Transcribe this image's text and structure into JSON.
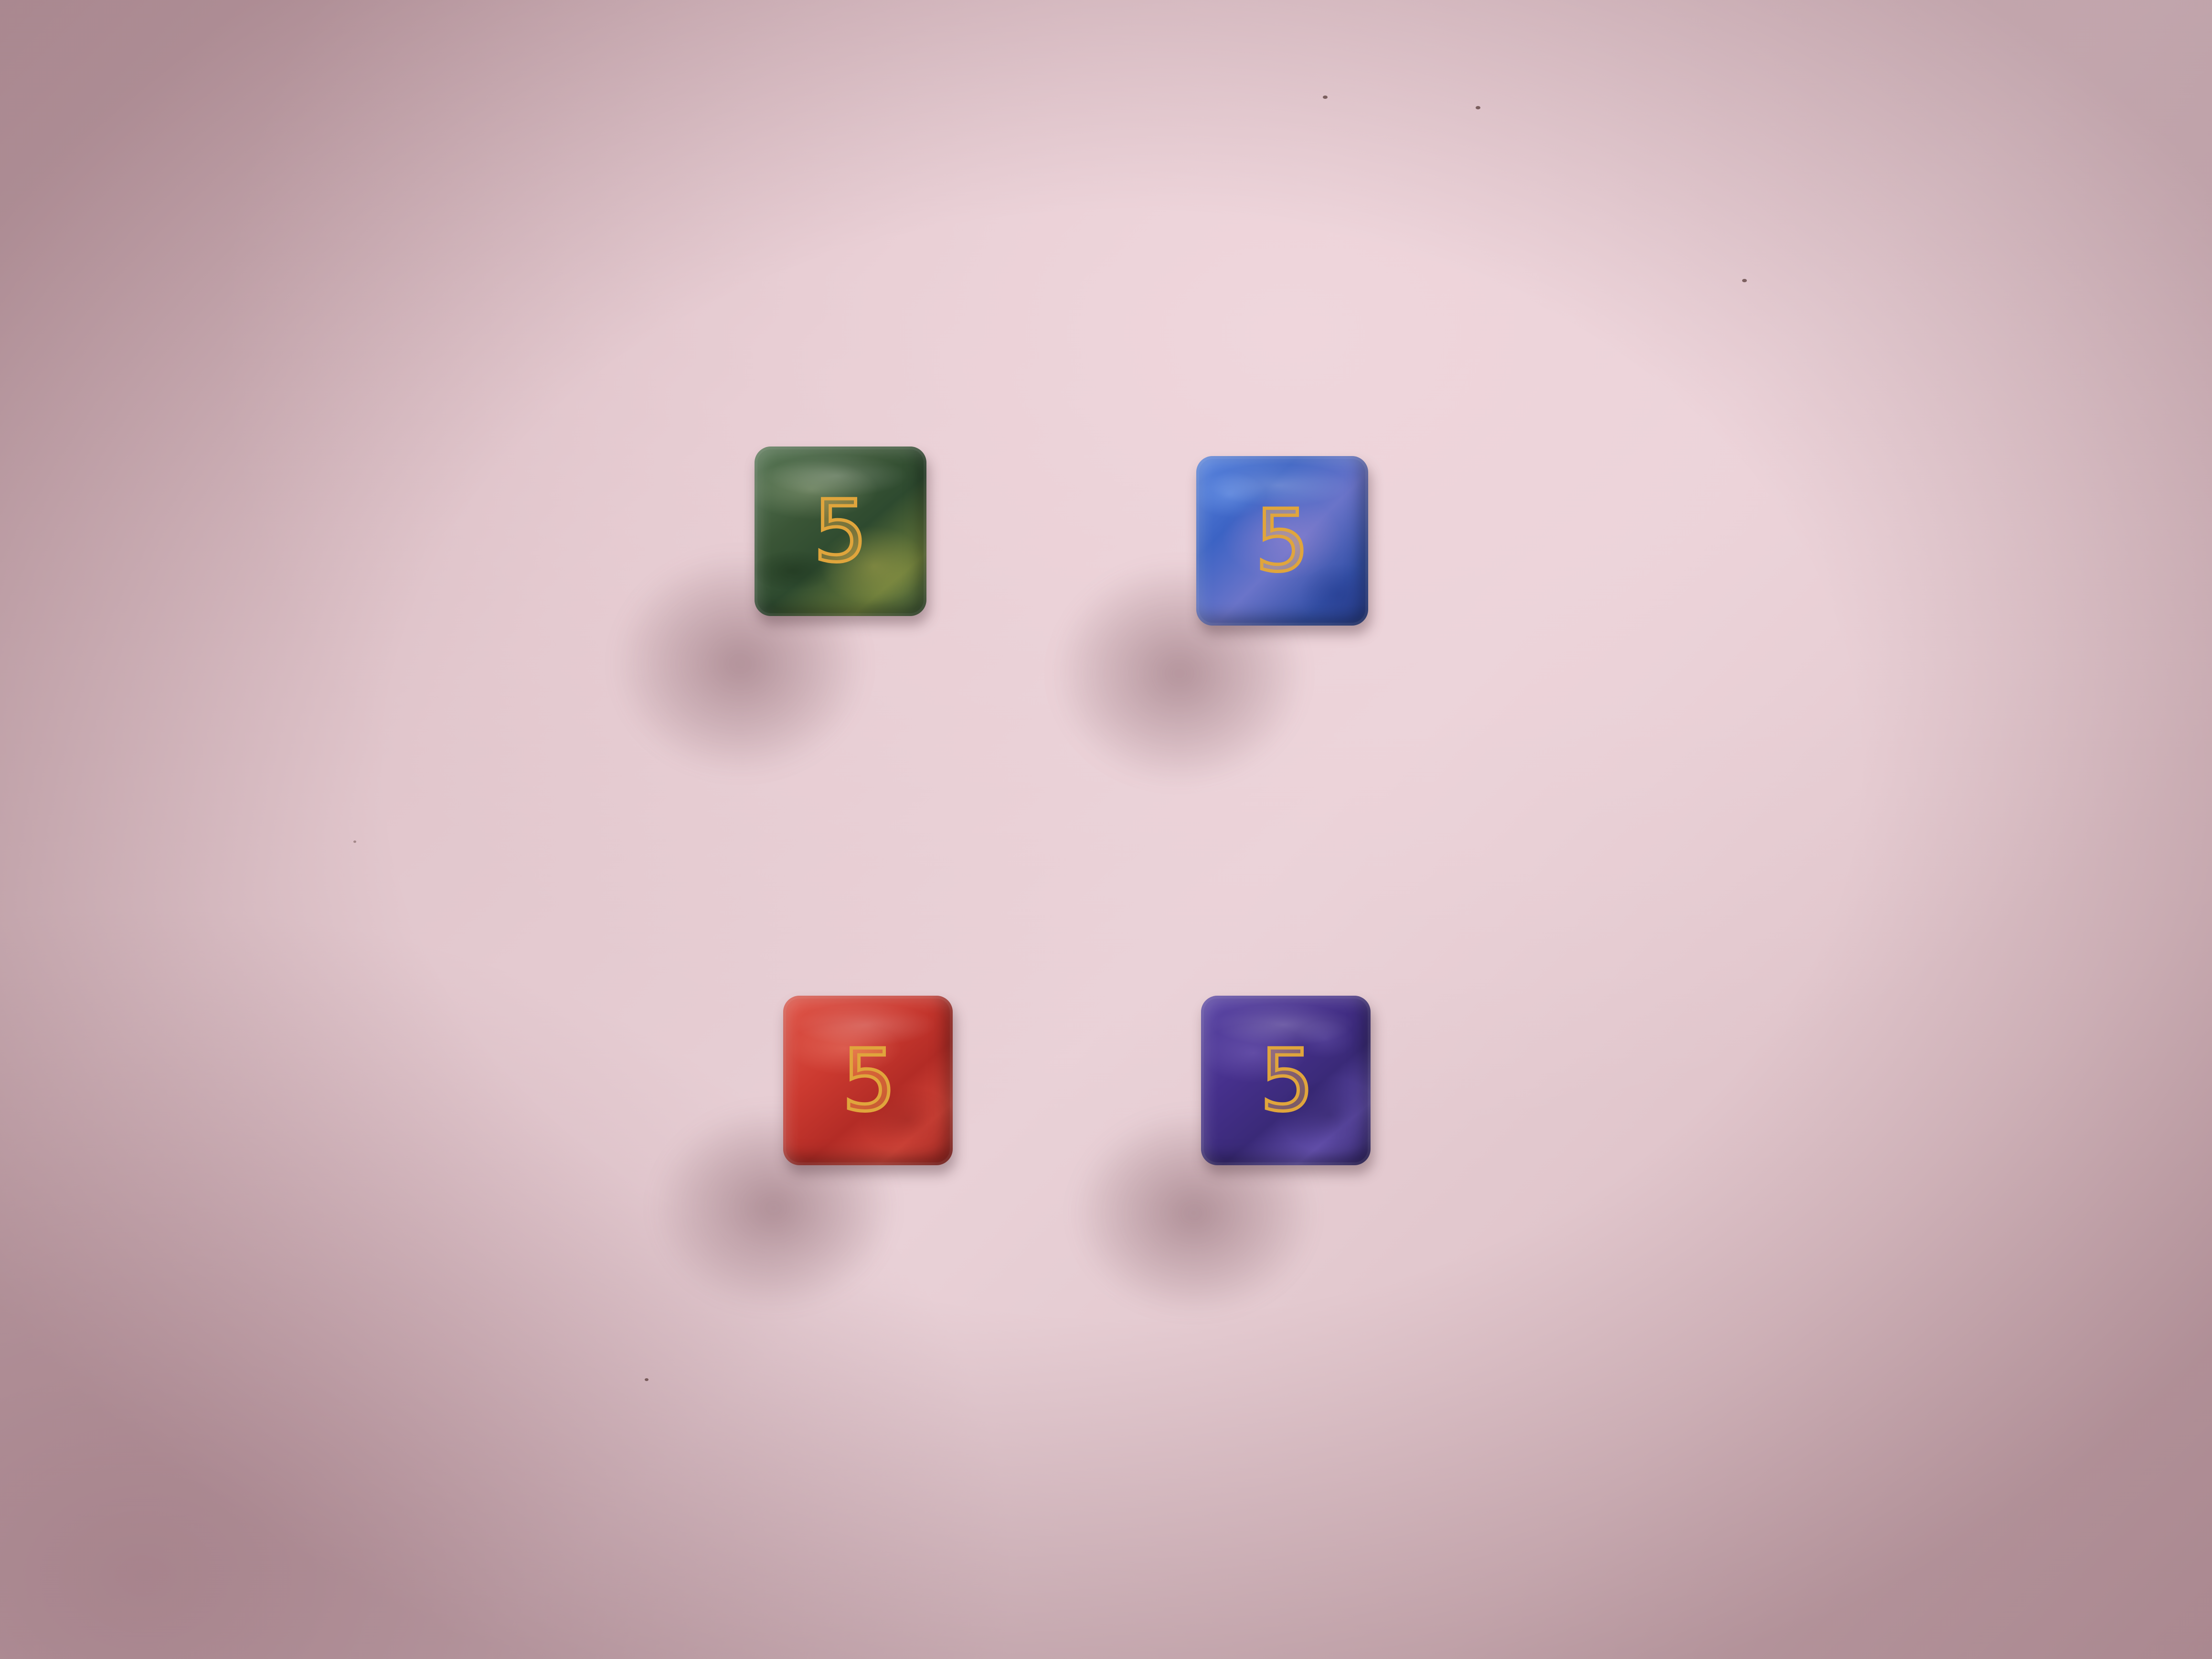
{
  "scene": {
    "description_free": true,
    "surface_color": "#e5cdd3"
  },
  "dice": [
    {
      "id": "green",
      "face_value": "5",
      "color": "#3f5a3c",
      "pip_color": "#e0a53c"
    },
    {
      "id": "blue",
      "face_value": "5",
      "color": "#3f5fb8",
      "pip_color": "#e0a53c"
    },
    {
      "id": "red",
      "face_value": "5",
      "color": "#c2362e",
      "pip_color": "#e0a53c"
    },
    {
      "id": "purple",
      "face_value": "5",
      "color": "#4a338f",
      "pip_color": "#e0a53c"
    }
  ]
}
